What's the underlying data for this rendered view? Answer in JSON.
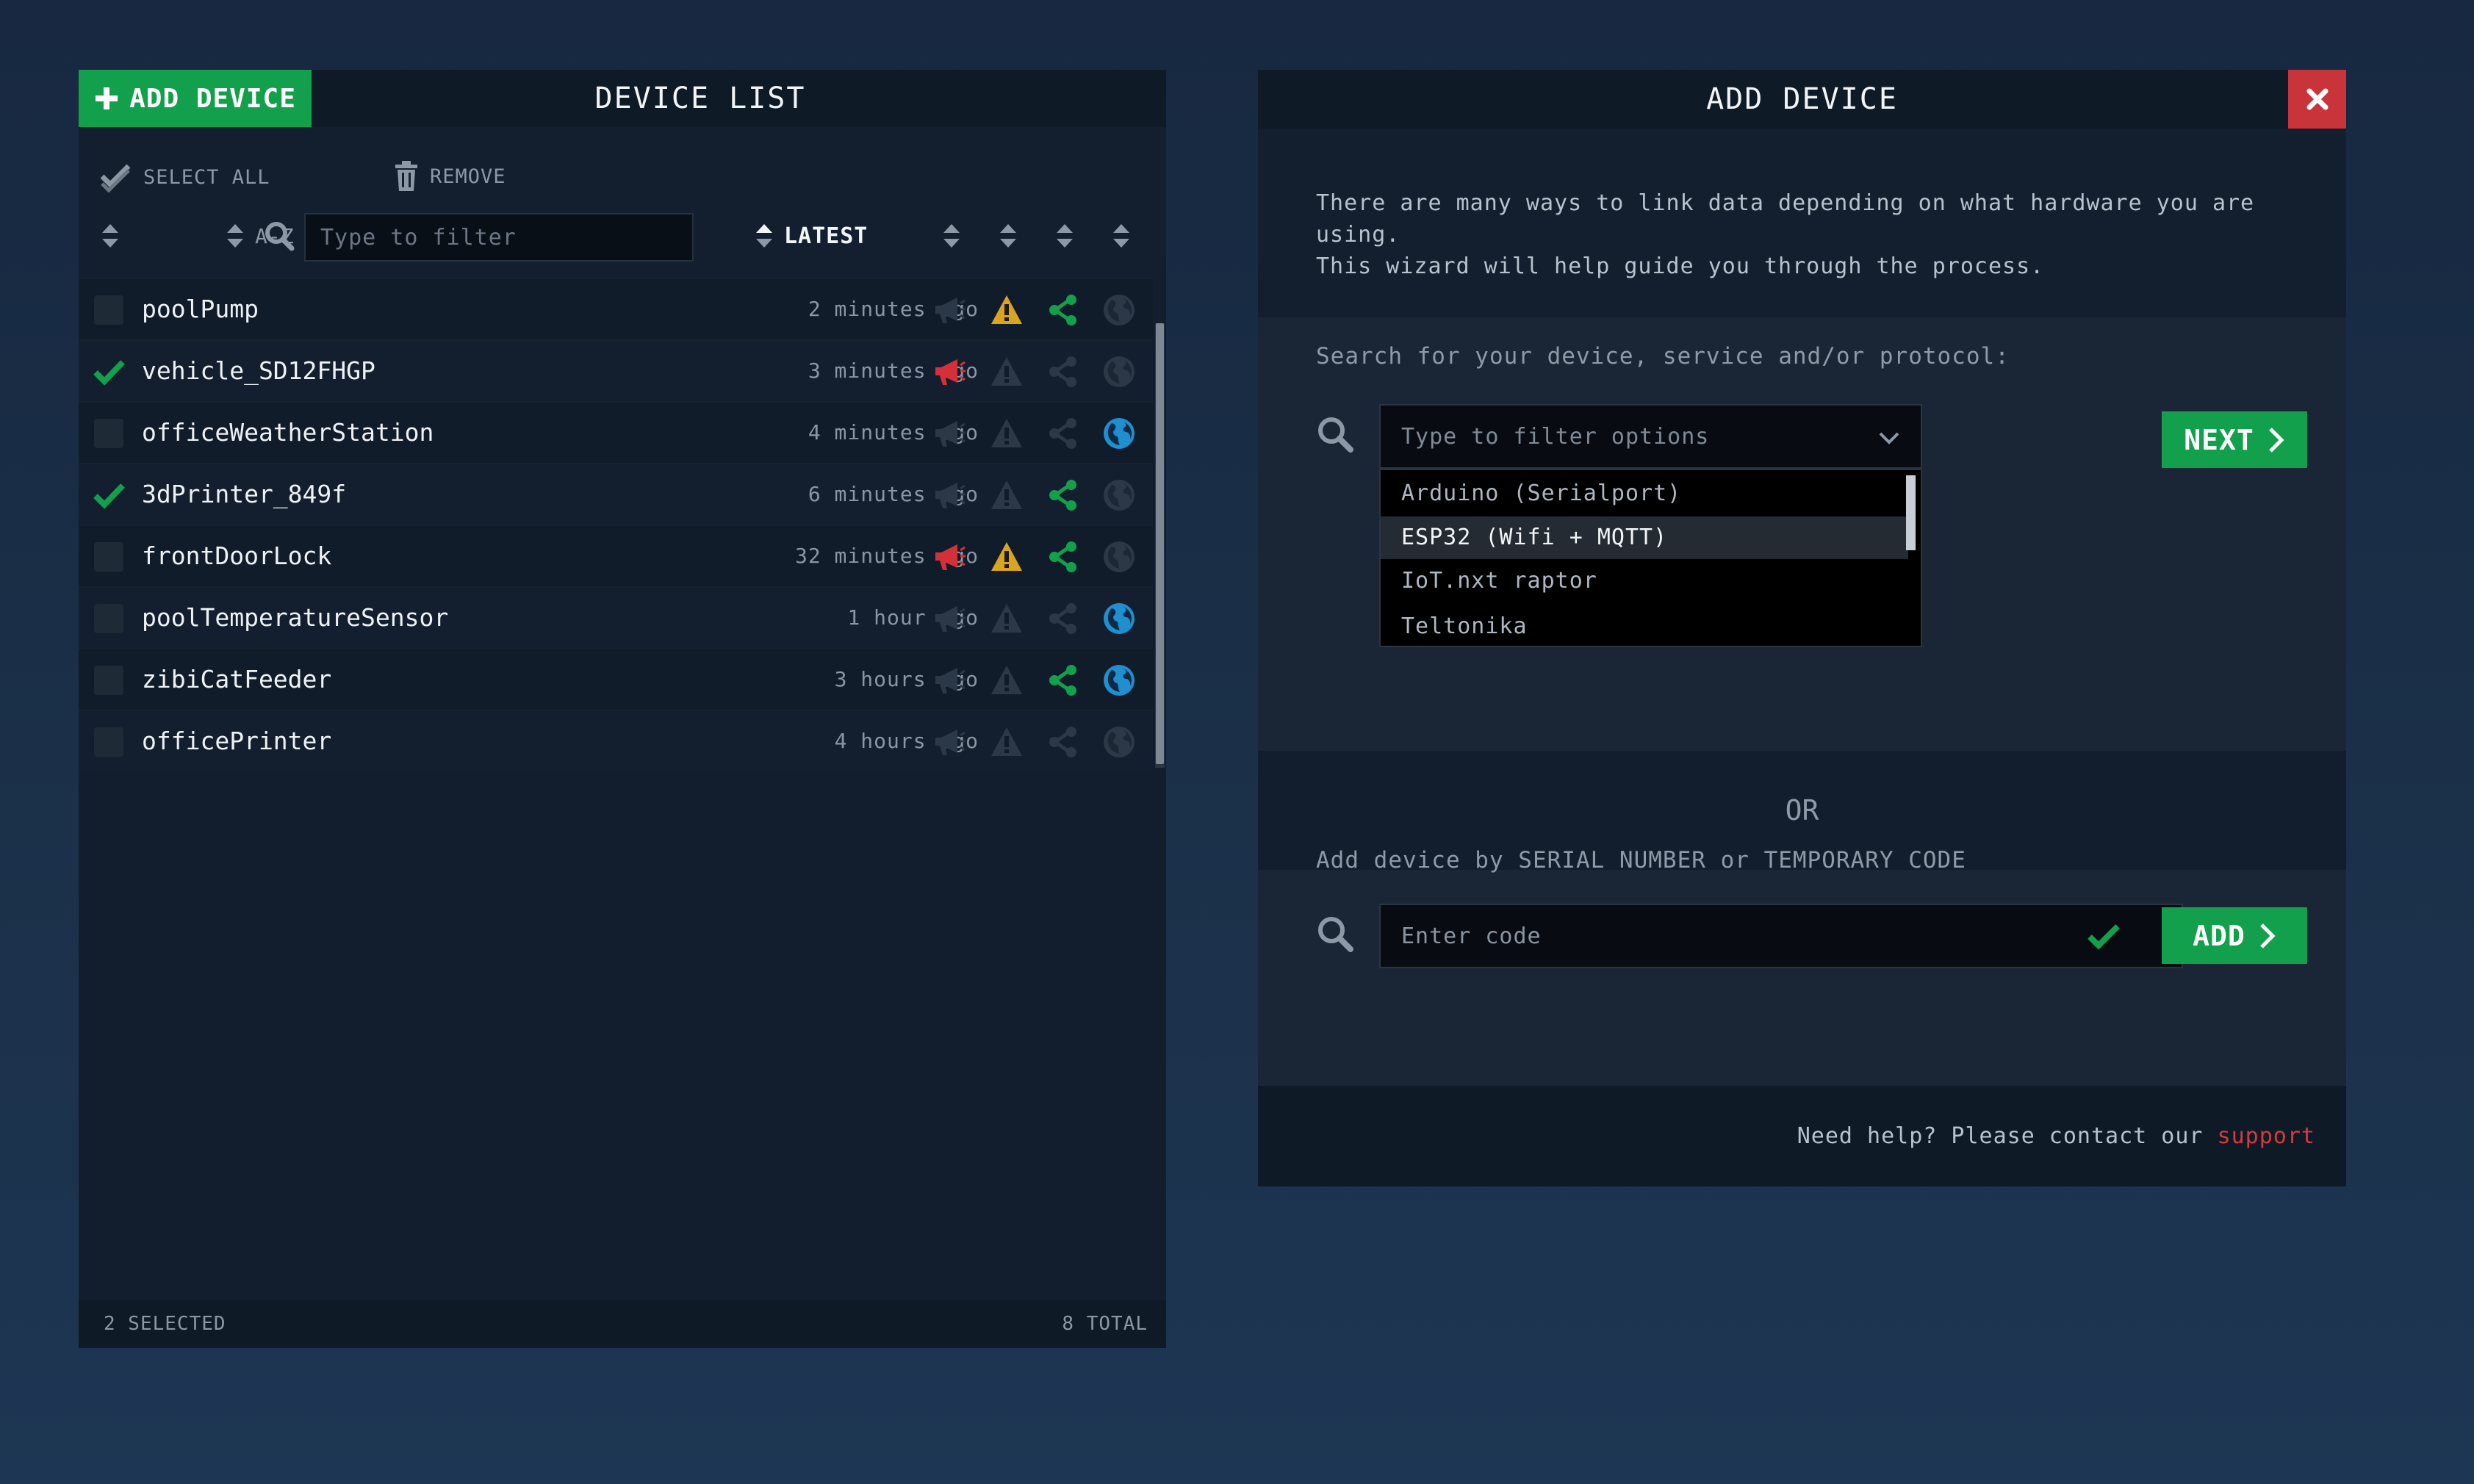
{
  "device_list": {
    "add_button_label": "ADD DEVICE",
    "title": "DEVICE LIST",
    "select_all_label": "SELECT ALL",
    "remove_label": "REMOVE",
    "sort_az_label": "A-Z",
    "filter_placeholder": "Type to filter",
    "sort_latest_label": "LATEST",
    "devices": [
      {
        "name": "poolPump",
        "time": "2 minutes ago",
        "checked": false,
        "alarm": false,
        "warning": true,
        "share": true,
        "globe": false
      },
      {
        "name": "vehicle_SD12FHGP",
        "time": "3 minutes ago",
        "checked": true,
        "alarm": true,
        "warning": false,
        "share": false,
        "globe": false
      },
      {
        "name": "officeWeatherStation",
        "time": "4 minutes ago",
        "checked": false,
        "alarm": false,
        "warning": false,
        "share": false,
        "globe": true
      },
      {
        "name": "3dPrinter_849f",
        "time": "6 minutes ago",
        "checked": true,
        "alarm": false,
        "warning": false,
        "share": true,
        "globe": false
      },
      {
        "name": "frontDoorLock",
        "time": "32 minutes ago",
        "checked": false,
        "alarm": true,
        "warning": true,
        "share": true,
        "globe": false
      },
      {
        "name": "poolTemperatureSensor",
        "time": "1 hour ago",
        "checked": false,
        "alarm": false,
        "warning": false,
        "share": false,
        "globe": true
      },
      {
        "name": "zibiCatFeeder",
        "time": "3 hours ago",
        "checked": false,
        "alarm": false,
        "warning": false,
        "share": true,
        "globe": true
      },
      {
        "name": "officePrinter",
        "time": "4 hours ago",
        "checked": false,
        "alarm": false,
        "warning": false,
        "share": false,
        "globe": false
      }
    ],
    "selected_count": "2 SELECTED",
    "total_count": "8 TOTAL"
  },
  "add_device": {
    "title": "ADD DEVICE",
    "intro_text": "There are many ways to link data depending on what hardware you are using.\nThis wizard will help guide you through the process.",
    "search_label": "Search for your device, service and/or protocol:",
    "combo_placeholder": "Type to filter options",
    "options": [
      "Arduino (Serialport)",
      "ESP32 (Wifi + MQTT)",
      "IoT.nxt raptor",
      "Teltonika"
    ],
    "selected_option": "ESP32 (Wifi + MQTT)",
    "next_label": "NEXT",
    "or_label": "OR",
    "code_label": "Add device by SERIAL NUMBER or TEMPORARY CODE",
    "code_placeholder": "Enter code",
    "add_label": "ADD",
    "help_text": "Need help? Please contact our",
    "support_link": "support"
  },
  "colors": {
    "accent_green": "#13a04c",
    "alarm_red": "#d4303a",
    "warning_yellow": "#d9a521",
    "globe_blue": "#1f8fd0",
    "close_red": "#c9333a"
  },
  "icons": {
    "alarm": "megaphone-icon",
    "warning": "warning-triangle-icon",
    "share": "share-icon",
    "globe": "globe-icon"
  }
}
